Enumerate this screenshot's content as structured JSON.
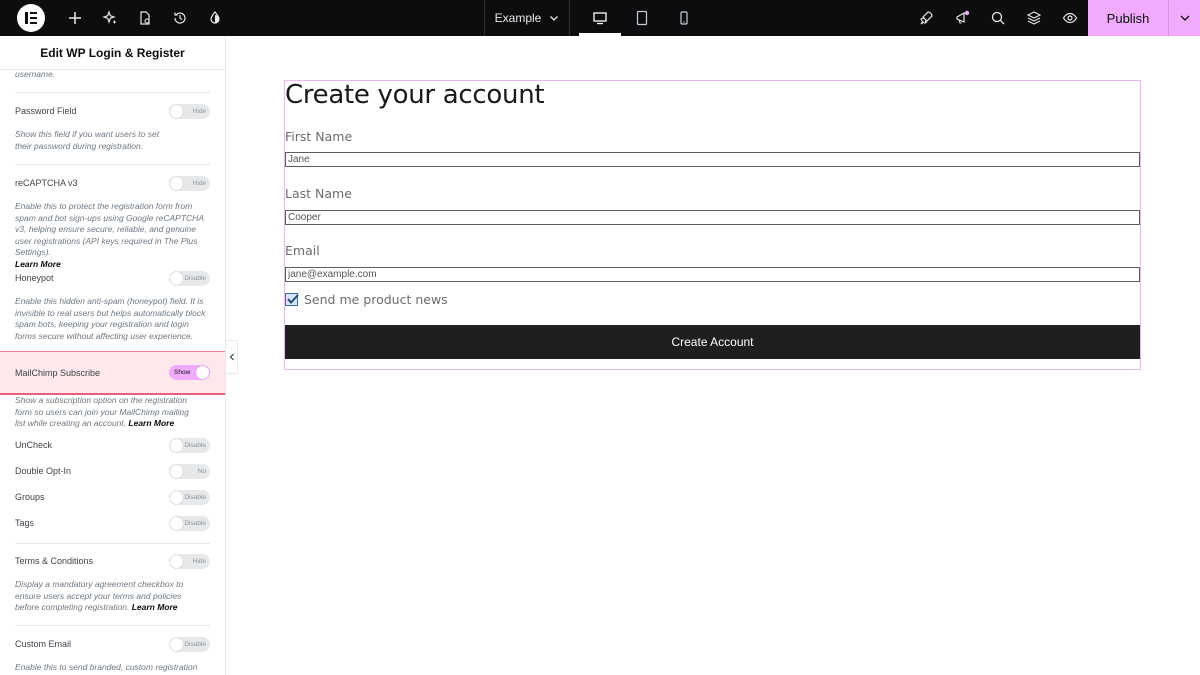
{
  "topbar": {
    "page_selector": "Example",
    "publish_label": "Publish"
  },
  "sidebar": {
    "title": "Edit WP Login & Register",
    "truncated_top": "username.",
    "sections": {
      "password": {
        "label": "Password Field",
        "toggle": "Hide",
        "desc": "Show this field if you want users to set their password during registration."
      },
      "recaptcha": {
        "label": "reCAPTCHA v3",
        "toggle": "Hide",
        "desc": "Enable this to protect the registration form from spam and bot sign-ups using Google reCAPTCHA v3, helping ensure secure, reliable, and genuine user registrations (API keys required in The Plus Settings).",
        "link": "Learn More"
      },
      "honeypot": {
        "label": "Honeypot",
        "toggle": "Disable",
        "desc": "Enable this hidden anti-spam (honeypot) field. It is invisible to real users but helps automatically block spam bots, keeping your registration and login forms secure without affecting user experience."
      },
      "mailchimp": {
        "label": "MailChimp Subscribe",
        "toggle": "Show",
        "desc": "Show a subscription option on the registration form so users can join your MailChimp mailing list while creating an account.",
        "link": "Learn More"
      },
      "uncheck": {
        "label": "UnCheck",
        "toggle": "Disable"
      },
      "double_optin": {
        "label": "Double Opt-In",
        "toggle": "No"
      },
      "groups": {
        "label": "Groups",
        "toggle": "Disable"
      },
      "tags": {
        "label": "Tags",
        "toggle": "Disable"
      },
      "terms": {
        "label": "Terms & Conditions",
        "toggle": "Hide",
        "desc": "Display a mandatory agreement checkbox to ensure users accept your terms and policies before completing registration.",
        "link": "Learn More"
      },
      "custom_email": {
        "label": "Custom Email",
        "toggle": "Disable",
        "desc": "Enable this to send branded, custom registration"
      }
    }
  },
  "form": {
    "title": "Create your account",
    "first_name_label": "First Name",
    "first_name_value": "Jane",
    "last_name_label": "Last Name",
    "last_name_value": "Cooper",
    "email_label": "Email",
    "email_value": "jane@example.com",
    "newsletter_label": "Send me product news",
    "newsletter_checked": true,
    "submit_label": "Create Account"
  },
  "colors": {
    "accent": "#f0abfc",
    "topbar": "#0c0d0e",
    "highlight_border": "#ec5f7c"
  }
}
